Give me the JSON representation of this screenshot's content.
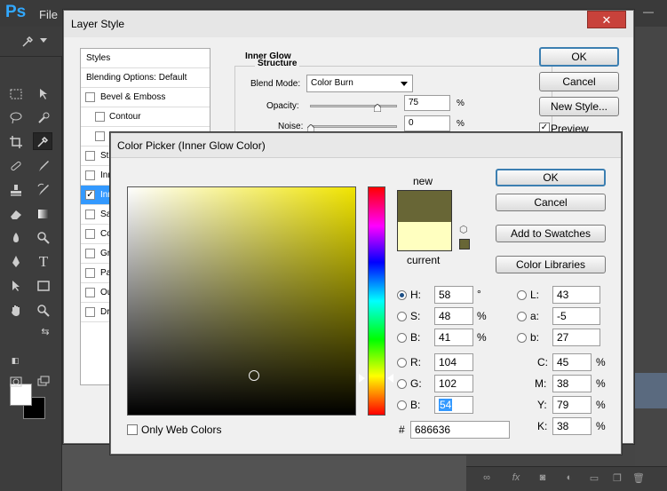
{
  "ps": {
    "logo": "Ps",
    "file_menu": "File"
  },
  "layer_style": {
    "title": "Layer Style",
    "close": "✕",
    "styles_list": [
      {
        "label": "Styles",
        "checkbox": false
      },
      {
        "label": "Blending Options: Default",
        "checkbox": false
      },
      {
        "label": "Bevel & Emboss",
        "checkbox": true,
        "checked": false
      },
      {
        "label": "Contour",
        "checkbox": true,
        "checked": false
      },
      {
        "label": "",
        "checkbox": true,
        "checked": false
      },
      {
        "label": "Str",
        "checkbox": true,
        "checked": false
      },
      {
        "label": "Inn",
        "checkbox": true,
        "checked": false
      },
      {
        "label": "Inn",
        "checkbox": true,
        "checked": true,
        "selected": true
      },
      {
        "label": "Sa",
        "checkbox": true,
        "checked": false
      },
      {
        "label": "Co",
        "checkbox": true,
        "checked": false
      },
      {
        "label": "Gr",
        "checkbox": true,
        "checked": false
      },
      {
        "label": "Pa",
        "checkbox": true,
        "checked": false
      },
      {
        "label": "Ou",
        "checkbox": true,
        "checked": false
      },
      {
        "label": "Dr",
        "checkbox": true,
        "checked": false
      }
    ],
    "inner_glow_title": "Inner Glow",
    "structure_title": "Structure",
    "blend_mode_label": "Blend Mode:",
    "blend_mode_value": "Color Burn",
    "opacity_label": "Opacity:",
    "opacity_value": "75",
    "noise_label": "Noise:",
    "noise_value": "0",
    "percent": "%",
    "buttons": {
      "ok": "OK",
      "cancel": "Cancel",
      "new_style": "New Style..."
    },
    "preview_label": "Preview",
    "preview_checked": true
  },
  "color_picker": {
    "title": "Color Picker (Inner Glow Color)",
    "new_label": "new",
    "current_label": "current",
    "new_color": "#686636",
    "current_color": "#ffffc0",
    "buttons": {
      "ok": "OK",
      "cancel": "Cancel",
      "add_to_swatches": "Add to Swatches",
      "color_libraries": "Color Libraries"
    },
    "hsb": {
      "h_label": "H:",
      "h": "58",
      "h_unit": "°",
      "s_label": "S:",
      "s": "48",
      "s_unit": "%",
      "b_label": "B:",
      "b": "41",
      "b_unit": "%"
    },
    "rgb": {
      "r_label": "R:",
      "r": "104",
      "g_label": "G:",
      "g": "102",
      "b_label": "B:",
      "b": "54"
    },
    "lab": {
      "l_label": "L:",
      "l": "43",
      "a_label": "a:",
      "a": "-5",
      "b_label": "b:",
      "b": "27"
    },
    "cmyk": {
      "c_label": "C:",
      "c": "45",
      "m_label": "M:",
      "m": "38",
      "y_label": "Y:",
      "y": "79",
      "k_label": "K:",
      "k": "38",
      "unit": "%"
    },
    "hash": "#",
    "hex": "686636",
    "only_web_colors": "Only Web Colors"
  }
}
